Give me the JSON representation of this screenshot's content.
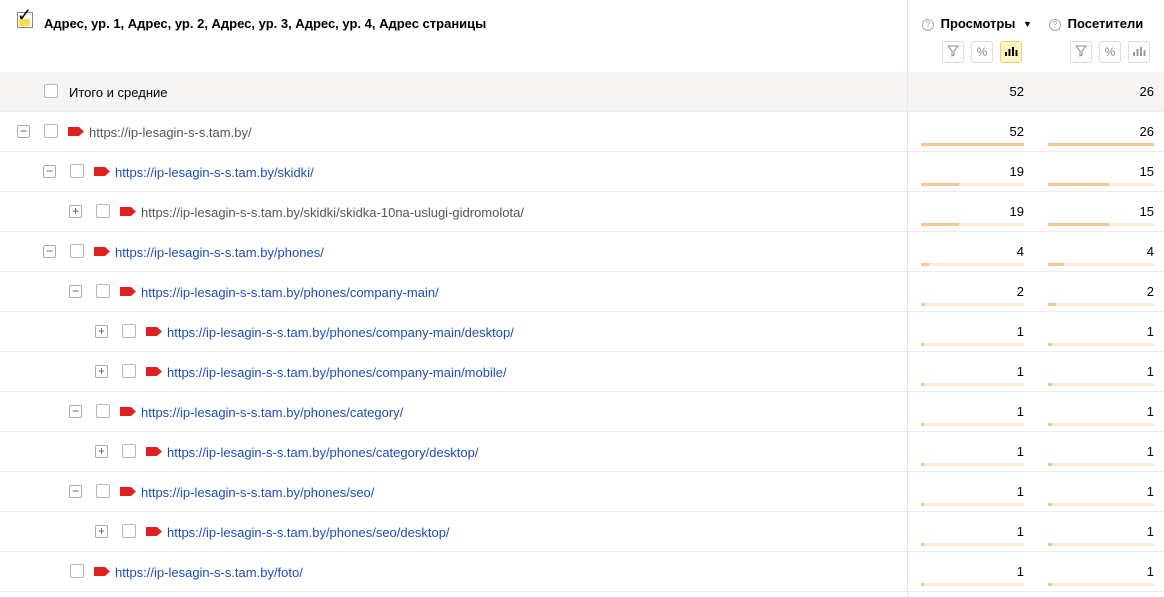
{
  "header": {
    "dimension_title": "Адрес, ур. 1, Адрес, ур. 2, Адрес, ур. 3, Адрес, ур. 4, Адрес страницы",
    "metrics": [
      {
        "label": "Просмотры",
        "help": "?",
        "sorted": "▼",
        "icons": [
          "filter-icon",
          "percent-icon",
          "bar-chart-icon"
        ],
        "active_icon": "bar-chart-icon"
      },
      {
        "label": "Посетители",
        "help": "?",
        "icons": [
          "filter-icon",
          "percent-icon",
          "bar-chart-icon"
        ]
      }
    ]
  },
  "totals": {
    "label": "Итого и средние",
    "views": "52",
    "visitors": "26"
  },
  "rows": [
    {
      "level": 0,
      "toggle": "−",
      "url": "https://ip-lesagin-s-s.tam.by/",
      "style": "grey",
      "views": "52",
      "visitors": "26",
      "views_frac": 1.0,
      "visitors_frac": 1.0
    },
    {
      "level": 1,
      "toggle": "−",
      "url": "https://ip-lesagin-s-s.tam.by/skidki/",
      "style": "blue",
      "views": "19",
      "visitors": "15",
      "views_frac": 0.365,
      "visitors_frac": 0.577
    },
    {
      "level": 2,
      "toggle": "+",
      "url": "https://ip-lesagin-s-s.tam.by/skidki/skidka-10na-uslugi-gidromolota/",
      "style": "grey",
      "views": "19",
      "visitors": "15",
      "views_frac": 0.365,
      "visitors_frac": 0.577
    },
    {
      "level": 1,
      "toggle": "−",
      "url": "https://ip-lesagin-s-s.tam.by/phones/",
      "style": "blue",
      "views": "4",
      "visitors": "4",
      "views_frac": 0.077,
      "visitors_frac": 0.154
    },
    {
      "level": 2,
      "toggle": "−",
      "url": "https://ip-lesagin-s-s.tam.by/phones/company-main/",
      "style": "blue",
      "views": "2",
      "visitors": "2",
      "views_frac": 0.038,
      "visitors_frac": 0.077
    },
    {
      "level": 3,
      "toggle": "+",
      "url": "https://ip-lesagin-s-s.tam.by/phones/company-main/desktop/",
      "style": "blue",
      "views": "1",
      "visitors": "1",
      "views_frac": 0.019,
      "visitors_frac": 0.038
    },
    {
      "level": 3,
      "toggle": "+",
      "url": "https://ip-lesagin-s-s.tam.by/phones/company-main/mobile/",
      "style": "blue",
      "views": "1",
      "visitors": "1",
      "views_frac": 0.019,
      "visitors_frac": 0.038
    },
    {
      "level": 2,
      "toggle": "−",
      "url": "https://ip-lesagin-s-s.tam.by/phones/category/",
      "style": "blue",
      "views": "1",
      "visitors": "1",
      "views_frac": 0.019,
      "visitors_frac": 0.038
    },
    {
      "level": 3,
      "toggle": "+",
      "url": "https://ip-lesagin-s-s.tam.by/phones/category/desktop/",
      "style": "blue",
      "views": "1",
      "visitors": "1",
      "views_frac": 0.019,
      "visitors_frac": 0.038
    },
    {
      "level": 2,
      "toggle": "−",
      "url": "https://ip-lesagin-s-s.tam.by/phones/seo/",
      "style": "blue",
      "views": "1",
      "visitors": "1",
      "views_frac": 0.019,
      "visitors_frac": 0.038
    },
    {
      "level": 3,
      "toggle": "+",
      "url": "https://ip-lesagin-s-s.tam.by/phones/seo/desktop/",
      "style": "blue",
      "views": "1",
      "visitors": "1",
      "views_frac": 0.019,
      "visitors_frac": 0.038
    },
    {
      "level": 1,
      "toggle": "",
      "url": "https://ip-lesagin-s-s.tam.by/foto/",
      "style": "blue",
      "views": "1",
      "visitors": "1",
      "views_frac": 0.019,
      "visitors_frac": 0.038
    }
  ],
  "colors": {
    "tag": "#e02020",
    "link": "#1a4fb8",
    "bar": "#f5c78e",
    "bar_bg": "#fdebd7",
    "active_ctrl": "#fff3c2"
  }
}
